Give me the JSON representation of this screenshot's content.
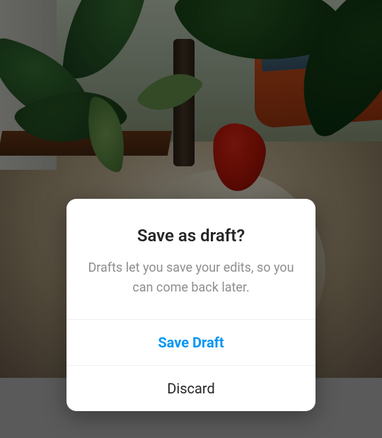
{
  "dialog": {
    "title": "Save as draft?",
    "message": "Drafts let you save your edits, so you can come back later.",
    "primary_action": "Save Draft",
    "secondary_action": "Discard"
  }
}
